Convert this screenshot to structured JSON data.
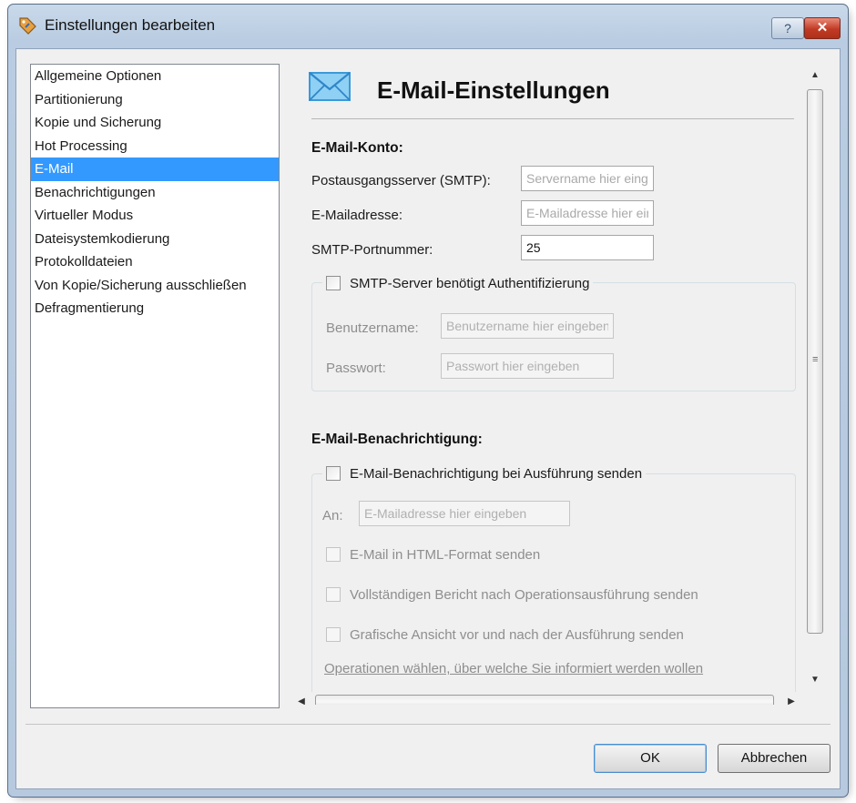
{
  "window": {
    "title": "Einstellungen bearbeiten",
    "help_glyph": "?",
    "close_glyph": "✕"
  },
  "nav": {
    "items": [
      {
        "label": "Allgemeine Optionen",
        "selected": false
      },
      {
        "label": "Partitionierung",
        "selected": false
      },
      {
        "label": "Kopie und Sicherung",
        "selected": false
      },
      {
        "label": "Hot Processing",
        "selected": false
      },
      {
        "label": "E-Mail",
        "selected": true
      },
      {
        "label": "Benachrichtigungen",
        "selected": false
      },
      {
        "label": "Virtueller Modus",
        "selected": false
      },
      {
        "label": "Dateisystemkodierung",
        "selected": false
      },
      {
        "label": "Protokolldateien",
        "selected": false
      },
      {
        "label": "Von Kopie/Sicherung ausschließen",
        "selected": false
      },
      {
        "label": "Defragmentierung",
        "selected": false
      }
    ]
  },
  "header": {
    "title": "E-Mail-Einstellungen",
    "icon": "envelope-icon"
  },
  "account": {
    "section_title": "E-Mail-Konto:",
    "smtp_label": "Postausgangsserver (SMTP):",
    "smtp_placeholder": "Servername hier eingeben",
    "email_label": "E-Mailadresse:",
    "email_placeholder": "E-Mailadresse hier eingeben",
    "port_label": "SMTP-Portnummer:",
    "port_value": "25",
    "auth_label": "SMTP-Server benötigt Authentifizierung",
    "auth_checked": false,
    "user_label": "Benutzername:",
    "user_placeholder": "Benutzername hier eingeben",
    "pass_label": "Passwort:",
    "pass_placeholder": "Passwort hier eingeben"
  },
  "notify": {
    "section_title": "E-Mail-Benachrichtigung:",
    "send_label": "E-Mail-Benachrichtigung bei Ausführung senden",
    "send_checked": false,
    "to_label": "An:",
    "to_placeholder": "E-Mailadresse hier eingeben",
    "html_label": "E-Mail in HTML-Format senden",
    "report_label": "Vollständigen Bericht nach Operationsausführung senden",
    "graphic_label": "Grafische Ansicht vor und nach der Ausführung senden",
    "ops_link": "Operationen wählen, über welche Sie informiert werden wollen"
  },
  "buttons": {
    "ok": "OK",
    "cancel": "Abbrechen"
  },
  "colors": {
    "selection": "#3399ff",
    "title_bar": "#c9d9ea",
    "close": "#c13a24"
  }
}
